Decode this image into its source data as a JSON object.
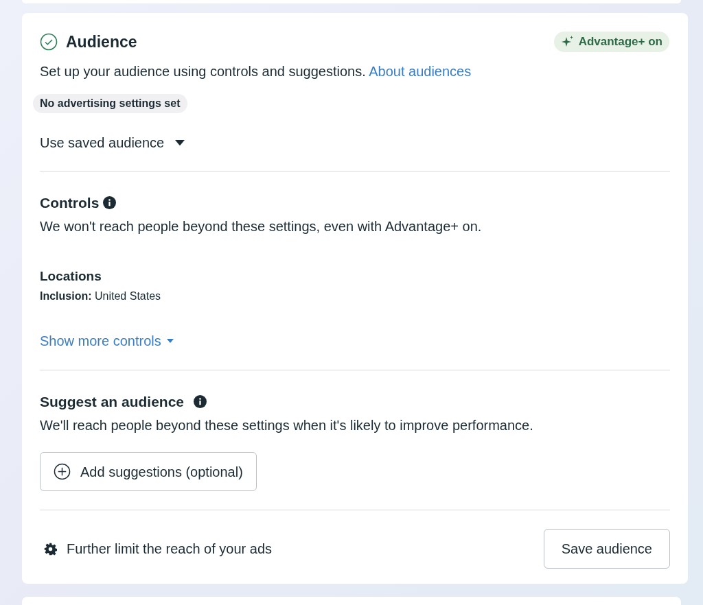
{
  "header": {
    "title": "Audience",
    "badge": "Advantage+ on"
  },
  "intro": {
    "text": "Set up your audience using controls and suggestions.",
    "link": "About audiences"
  },
  "status_pill": "No advertising settings set",
  "saved_audience_dropdown": "Use saved audience",
  "controls": {
    "title": "Controls",
    "description": "We won't reach people beyond these settings, even with Advantage+ on.",
    "locations": {
      "title": "Locations",
      "value": "**Inclusion:** United States"
    },
    "show_more": "Show more controls"
  },
  "suggest": {
    "title": "Suggest an audience",
    "description": "We'll reach people beyond these settings when it's likely to improve performance.",
    "button": "Add suggestions (optional)"
  },
  "footer": {
    "link": "Further limit the reach of your ads",
    "button": "Save audience"
  }
}
